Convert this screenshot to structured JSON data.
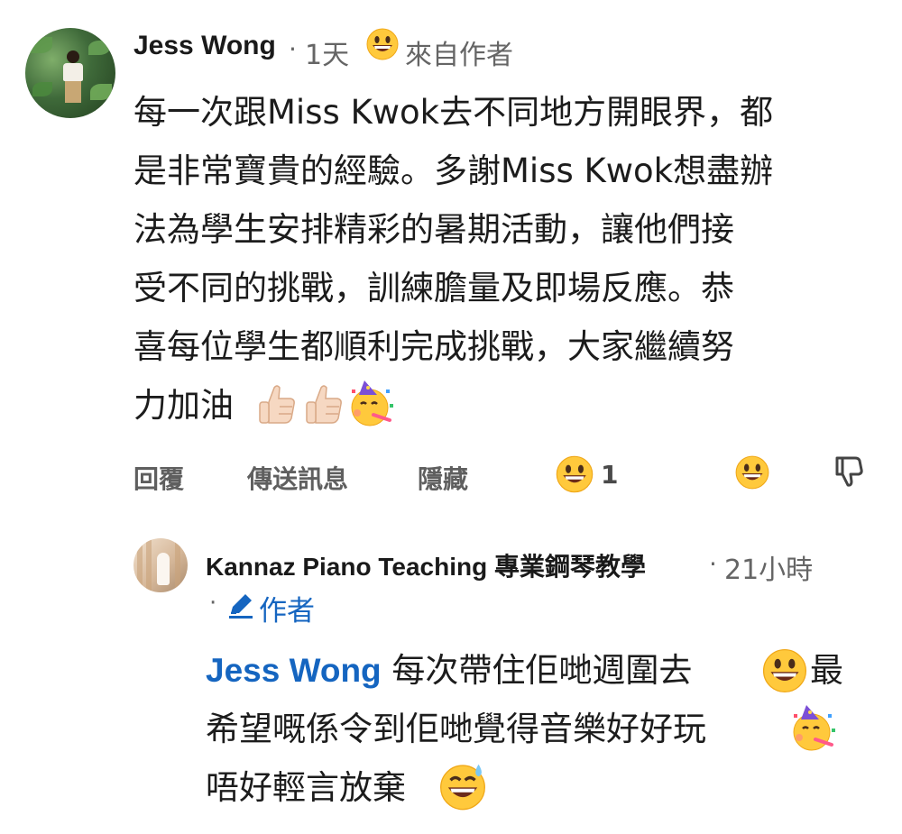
{
  "comment": {
    "author": "Jess Wong",
    "separator": "·",
    "time": "1天",
    "badge": "來自作者",
    "lines": [
      "每一次跟Miss Kwok去不同地方開眼界，都",
      "是非常寶貴的經驗。多謝Miss Kwok想盡辦",
      "法為學生安排精彩的暑期活動，讓他們接",
      "受不同的挑戰，訓練膽量及即場反應。恭",
      "喜每位學生都順利完成挑戰，大家繼續努",
      "力加油"
    ],
    "trailing_emojis": [
      "thumbs-up-icon",
      "thumbs-up-icon",
      "partying-face-icon"
    ],
    "actions": {
      "reply": "回覆",
      "message": "傳送訊息",
      "hide": "隱藏"
    },
    "reaction_count": "1"
  },
  "reply": {
    "author": "Kannaz Piano Teaching 專業鋼琴教學",
    "separator": "·",
    "time": "21小時",
    "badge_separator": "·",
    "badge": "作者",
    "mention": "Jess Wong",
    "line1_text": "每次帶住佢哋週圍去",
    "line1_end": "最",
    "line2_text": "希望嘅係令到佢哋覺得音樂好好玩",
    "line3_text": "唔好輕言放棄"
  },
  "colors": {
    "mention": "#1565c0",
    "action_gray": "#5f5f5f",
    "emoji_yellow": "#ffc93c"
  }
}
